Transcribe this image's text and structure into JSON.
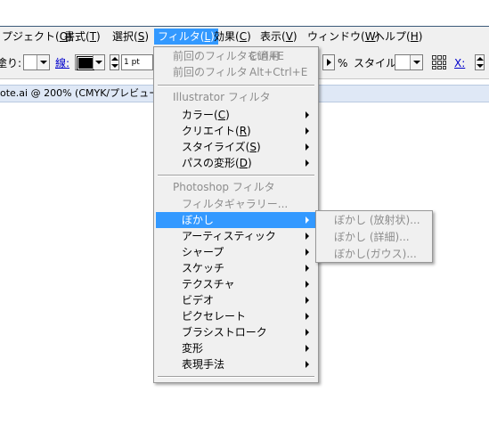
{
  "menubar": {
    "items": [
      {
        "label": "プジェクト(O)",
        "text": "プジェクト(",
        "key": "O",
        "tail": ")"
      },
      {
        "label": "書式(T)",
        "text": "書式(",
        "key": "T",
        "tail": ")"
      },
      {
        "label": "選択(S)",
        "text": "選択(",
        "key": "S",
        "tail": ")"
      },
      {
        "label": "フィルタ(L)",
        "text": "フィルタ(",
        "key": "L",
        "tail": ")"
      },
      {
        "label": "効果(C)",
        "text": "効果(",
        "key": "C",
        "tail": ")"
      },
      {
        "label": "表示(V)",
        "text": "表示(",
        "key": "V",
        "tail": ")"
      },
      {
        "label": "ウィンドウ(W)",
        "text": "ウィンドウ(",
        "key": "W",
        "tail": ")"
      },
      {
        "label": "ヘルプ(H)",
        "text": "ヘルプ(",
        "key": "H",
        "tail": ")"
      }
    ]
  },
  "toolbar": {
    "fill_label": "塗り:",
    "stroke_label": "線:",
    "stroke_weight": "1 pt",
    "opacity_unit": "%",
    "style_label": "スタイル:",
    "x_label": "X:"
  },
  "document_tab": {
    "title": "ote.ai @ 200% (CMYK/プレビュー)"
  },
  "filter_menu": {
    "recent": [
      {
        "label": "前回のフィルタを適用",
        "shortcut": "Ctrl+E"
      },
      {
        "label": "前回のフィルタ",
        "shortcut": "Alt+Ctrl+E"
      }
    ],
    "illustrator_header": "Illustrator フィルタ",
    "illustrator_items": [
      {
        "text": "カラー(",
        "key": "C",
        "tail": ")"
      },
      {
        "text": "クリエイト(",
        "key": "R",
        "tail": ")"
      },
      {
        "text": "スタイライズ(",
        "key": "S",
        "tail": ")"
      },
      {
        "text": "パスの変形(",
        "key": "D",
        "tail": ")"
      }
    ],
    "photoshop_header": "Photoshop フィルタ",
    "filter_gallery": "フィルタギャラリー...",
    "photoshop_items": [
      {
        "label": "ぼかし",
        "selected": true
      },
      {
        "label": "アーティスティック"
      },
      {
        "label": "シャープ"
      },
      {
        "label": "スケッチ"
      },
      {
        "label": "テクスチャ"
      },
      {
        "label": "ビデオ"
      },
      {
        "label": "ピクセレート"
      },
      {
        "label": "ブラシストローク"
      },
      {
        "label": "変形"
      },
      {
        "label": "表現手法"
      }
    ]
  },
  "blur_submenu": {
    "items": [
      {
        "label": "ぼかし (放射状)..."
      },
      {
        "label": "ぼかし (詳細)..."
      },
      {
        "label": "ぼかし(ガウス)..."
      }
    ]
  },
  "colors": {
    "highlight": "#3399ff",
    "menu_bg": "#f0f0f0",
    "disabled_text": "#8d8d8d",
    "doc_tab_bg": "#dfe8f6"
  }
}
